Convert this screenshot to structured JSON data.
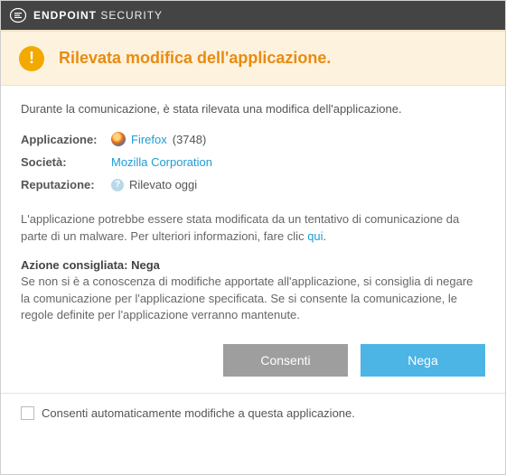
{
  "titlebar": {
    "brand": "eset",
    "product_bold": "ENDPOINT",
    "product_rest": "SECURITY"
  },
  "banner": {
    "headline": "Rilevata modifica dell'applicazione."
  },
  "intro": "Durante la comunicazione, è stata rilevata una modifica dell'applicazione.",
  "details": {
    "app_label": "Applicazione:",
    "app_name": "Firefox",
    "app_pid": "(3748)",
    "company_label": "Società:",
    "company_name": "Mozilla Corporation",
    "reputation_label": "Reputazione:",
    "reputation_value": "Rilevato oggi"
  },
  "notice_before_link": "L'applicazione potrebbe essere stata modificata da un tentativo di comunicazione da parte di un malware. Per ulteriori informazioni, fare clic ",
  "notice_link": "qui",
  "notice_after_link": ".",
  "recommend": {
    "title": "Azione consigliata: Nega",
    "text": "Se non si è a conoscenza di modifiche apportate all'applicazione, si consiglia di negare la comunicazione per l'applicazione specificata. Se si consente la comunicazione, le regole definite per l'applicazione verranno mantenute."
  },
  "buttons": {
    "allow": "Consenti",
    "deny": "Nega"
  },
  "footer": {
    "checkbox_label": "Consenti automaticamente modifiche a questa applicazione."
  }
}
